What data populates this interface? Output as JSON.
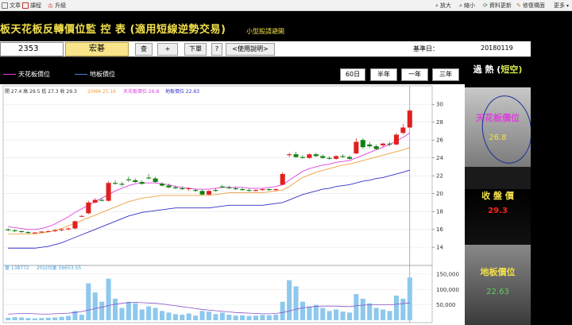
{
  "toolbar": {
    "items_left": [
      "文章",
      "課程",
      "升級"
    ],
    "items_right": [
      "放大",
      "縮小",
      "資料更新",
      "修復構面",
      "更多"
    ]
  },
  "title": {
    "main": "板天花板反轉價位監 控 表 (適用短線逆勢交易)",
    "sub": "小型股請避開"
  },
  "controls": {
    "stock_code": "2353",
    "stock_name": "宏碁",
    "query_label": "查",
    "add_label": "+",
    "next_label": "下單",
    "help_label": "?",
    "usage_label": "<使用說明>",
    "base_date_label": "基準日：",
    "base_date": "20180119"
  },
  "legend": {
    "ceiling": "天花板價位",
    "floor": "地板價位"
  },
  "periods": [
    "60日",
    "半年",
    "一年",
    "三年"
  ],
  "chart_info": {
    "ohlc": "開 27.4  高 29.5  低 27.3  收 29.3",
    "ma20": "20MA 25.16",
    "ceiling_info": "天花板價位 26.8",
    "floor_info": "地板價位 22.63",
    "vol": "量 138772",
    "vol_ma": "20日均量 56653.55"
  },
  "panel": {
    "head_a": "過 熱 (",
    "head_b": "短空",
    "head_c": ")",
    "ceiling_label": "天花板價位",
    "ceiling_value": "26.8",
    "close_label": "收 盤 價",
    "close_value": "29.3",
    "floor_label": "地板價位",
    "floor_value": "22.63"
  },
  "colors": {
    "ceiling": "#e040e0",
    "floor": "#3030c8",
    "ma20": "#f0a040",
    "up": "#e02020",
    "down": "#108010",
    "volume": "#8ec8ec",
    "accent_yellow": "#f2e04a"
  },
  "chart_data": {
    "type": "line",
    "price_ticks": [
      30,
      28,
      26,
      24,
      22,
      20,
      18,
      16,
      14
    ],
    "volume_ticks": [
      "150,000",
      "100,000",
      "50,000"
    ],
    "ylim": [
      12.5,
      31
    ],
    "candles": [
      [
        16.0,
        16.1,
        15.8,
        15.9
      ],
      [
        15.9,
        16.0,
        15.7,
        15.8
      ],
      [
        15.8,
        15.9,
        15.6,
        15.7
      ],
      [
        15.7,
        15.8,
        15.5,
        15.6
      ],
      [
        15.6,
        15.7,
        15.5,
        15.65
      ],
      [
        15.65,
        15.8,
        15.6,
        15.75
      ],
      [
        15.75,
        15.9,
        15.7,
        15.8
      ],
      [
        15.8,
        16.0,
        15.7,
        15.9
      ],
      [
        15.9,
        16.1,
        15.8,
        16.0
      ],
      [
        16.0,
        16.2,
        15.9,
        16.1
      ],
      [
        16.1,
        17.0,
        16.0,
        16.9
      ],
      [
        17.5,
        17.6,
        17.4,
        17.5
      ],
      [
        17.8,
        19.2,
        17.7,
        19.0
      ],
      [
        19.0,
        19.5,
        18.9,
        19.3
      ],
      [
        19.3,
        19.5,
        19.1,
        19.2
      ],
      [
        19.2,
        21.4,
        19.1,
        21.2
      ],
      [
        21.2,
        21.5,
        21.0,
        21.1
      ],
      [
        21.1,
        21.3,
        20.8,
        21.0
      ],
      [
        21.6,
        21.9,
        21.3,
        21.5
      ],
      [
        21.5,
        21.7,
        21.2,
        21.3
      ],
      [
        21.3,
        21.5,
        21.0,
        21.1
      ],
      [
        21.8,
        22.2,
        21.6,
        21.7
      ],
      [
        21.7,
        21.9,
        21.2,
        21.3
      ],
      [
        21.1,
        21.3,
        20.8,
        20.9
      ],
      [
        20.9,
        21.1,
        20.6,
        20.7
      ],
      [
        20.7,
        20.9,
        20.5,
        20.6
      ],
      [
        20.6,
        20.8,
        20.4,
        20.5
      ],
      [
        20.5,
        20.7,
        20.3,
        20.6
      ],
      [
        20.4,
        20.6,
        20.2,
        20.3
      ],
      [
        20.3,
        20.5,
        19.8,
        19.9
      ],
      [
        19.9,
        20.4,
        19.8,
        20.3
      ],
      [
        20.4,
        20.6,
        20.2,
        20.3
      ],
      [
        20.8,
        21.0,
        20.6,
        20.7
      ],
      [
        20.7,
        20.9,
        20.5,
        20.6
      ],
      [
        20.6,
        20.8,
        20.4,
        20.5
      ],
      [
        20.5,
        20.7,
        20.3,
        20.4
      ],
      [
        20.4,
        20.6,
        20.2,
        20.3
      ],
      [
        20.3,
        20.5,
        20.2,
        20.4
      ],
      [
        20.4,
        20.6,
        20.3,
        20.5
      ],
      [
        20.5,
        20.6,
        20.3,
        20.4
      ],
      [
        20.4,
        20.6,
        20.3,
        20.5
      ],
      [
        21.0,
        22.4,
        20.9,
        22.2
      ],
      [
        24.3,
        24.6,
        24.1,
        24.4
      ],
      [
        24.4,
        24.7,
        24.0,
        24.1
      ],
      [
        24.1,
        24.3,
        23.9,
        24.0
      ],
      [
        24.0,
        24.5,
        23.9,
        24.4
      ],
      [
        24.4,
        24.6,
        24.1,
        24.2
      ],
      [
        24.2,
        24.4,
        23.9,
        24.0
      ],
      [
        24.0,
        24.2,
        23.8,
        23.9
      ],
      [
        23.9,
        24.3,
        23.8,
        24.2
      ],
      [
        24.2,
        24.4,
        24.0,
        24.1
      ],
      [
        24.1,
        24.3,
        23.8,
        23.9
      ],
      [
        24.5,
        26.2,
        24.4,
        25.8
      ],
      [
        26.0,
        26.2,
        25.0,
        25.2
      ],
      [
        25.5,
        25.8,
        25.1,
        25.3
      ],
      [
        25.3,
        25.5,
        24.9,
        25.0
      ],
      [
        25.4,
        25.7,
        25.2,
        25.6
      ],
      [
        25.6,
        25.8,
        25.3,
        25.5
      ],
      [
        25.5,
        26.8,
        25.4,
        26.6
      ],
      [
        26.8,
        27.8,
        26.6,
        27.4
      ],
      [
        27.4,
        29.5,
        27.3,
        29.3
      ]
    ],
    "ceiling_line": [
      16.3,
      16.2,
      16.1,
      16.0,
      16.0,
      16.1,
      16.3,
      16.6,
      17.0,
      17.4,
      17.9,
      18.3,
      18.7,
      19.1,
      19.5,
      19.9,
      20.3,
      20.6,
      20.9,
      21.1,
      21.2,
      21.2,
      21.2,
      21.1,
      21.0,
      20.8,
      20.7,
      20.6,
      20.5,
      20.5,
      20.5,
      20.6,
      20.7,
      20.7,
      20.7,
      20.7,
      20.6,
      20.6,
      20.6,
      20.7,
      20.8,
      21.0,
      21.5,
      22.0,
      22.5,
      22.8,
      23.0,
      23.2,
      23.3,
      23.5,
      23.6,
      23.7,
      24.0,
      24.3,
      24.6,
      24.9,
      25.2,
      25.5,
      25.9,
      26.3,
      26.8
    ],
    "ma20_line": [
      15.5,
      15.5,
      15.5,
      15.5,
      15.5,
      15.6,
      15.7,
      15.9,
      16.1,
      16.4,
      16.7,
      17.0,
      17.3,
      17.6,
      17.9,
      18.2,
      18.5,
      18.8,
      19.1,
      19.3,
      19.5,
      19.6,
      19.7,
      19.8,
      19.8,
      19.8,
      19.8,
      19.8,
      19.8,
      19.8,
      19.8,
      19.9,
      20.0,
      20.1,
      20.1,
      20.1,
      20.1,
      20.1,
      20.1,
      20.2,
      20.3,
      20.4,
      20.8,
      21.3,
      21.8,
      22.1,
      22.4,
      22.6,
      22.8,
      23.0,
      23.2,
      23.3,
      23.5,
      23.7,
      23.9,
      24.1,
      24.3,
      24.5,
      24.7,
      24.9,
      25.16
    ],
    "floor_line": [
      13.9,
      13.9,
      13.9,
      13.9,
      13.9,
      14.0,
      14.1,
      14.3,
      14.5,
      14.8,
      15.1,
      15.4,
      15.7,
      16.0,
      16.3,
      16.6,
      16.9,
      17.2,
      17.5,
      17.7,
      17.9,
      18.0,
      18.1,
      18.2,
      18.3,
      18.4,
      18.4,
      18.4,
      18.4,
      18.4,
      18.4,
      18.5,
      18.6,
      18.7,
      18.7,
      18.7,
      18.7,
      18.7,
      18.7,
      18.8,
      18.9,
      19.0,
      19.3,
      19.6,
      19.9,
      20.1,
      20.3,
      20.5,
      20.6,
      20.8,
      20.9,
      21.0,
      21.2,
      21.4,
      21.5,
      21.7,
      21.8,
      22.0,
      22.2,
      22.4,
      22.63
    ],
    "volumes": [
      8000,
      10000,
      9000,
      7000,
      6000,
      7000,
      8000,
      9000,
      11000,
      14000,
      30000,
      18000,
      120000,
      90000,
      60000,
      135000,
      70000,
      40000,
      60000,
      55000,
      35000,
      45000,
      40000,
      30000,
      25000,
      20000,
      18000,
      22000,
      15000,
      30000,
      28000,
      20000,
      25000,
      18000,
      15000,
      16000,
      14000,
      15000,
      17000,
      16000,
      18000,
      60000,
      130000,
      110000,
      60000,
      45000,
      50000,
      40000,
      30000,
      35000,
      28000,
      25000,
      85000,
      70000,
      55000,
      40000,
      35000,
      30000,
      80000,
      70000,
      138772
    ],
    "volume_ma_line": [
      20000,
      21000,
      22000,
      22000,
      21000,
      20000,
      20000,
      21000,
      22000,
      23000,
      25000,
      28000,
      33000,
      38000,
      42000,
      48000,
      52000,
      55000,
      57000,
      58000,
      57000,
      56000,
      55000,
      53000,
      50000,
      47000,
      44000,
      41000,
      38000,
      35000,
      33000,
      31000,
      29000,
      27000,
      25000,
      24000,
      23000,
      22000,
      21000,
      21000,
      22000,
      25000,
      30000,
      36000,
      40000,
      43000,
      45000,
      46000,
      46000,
      46000,
      45000,
      44000,
      47000,
      49000,
      50000,
      50000,
      50000,
      50000,
      52000,
      54000,
      56653
    ]
  }
}
